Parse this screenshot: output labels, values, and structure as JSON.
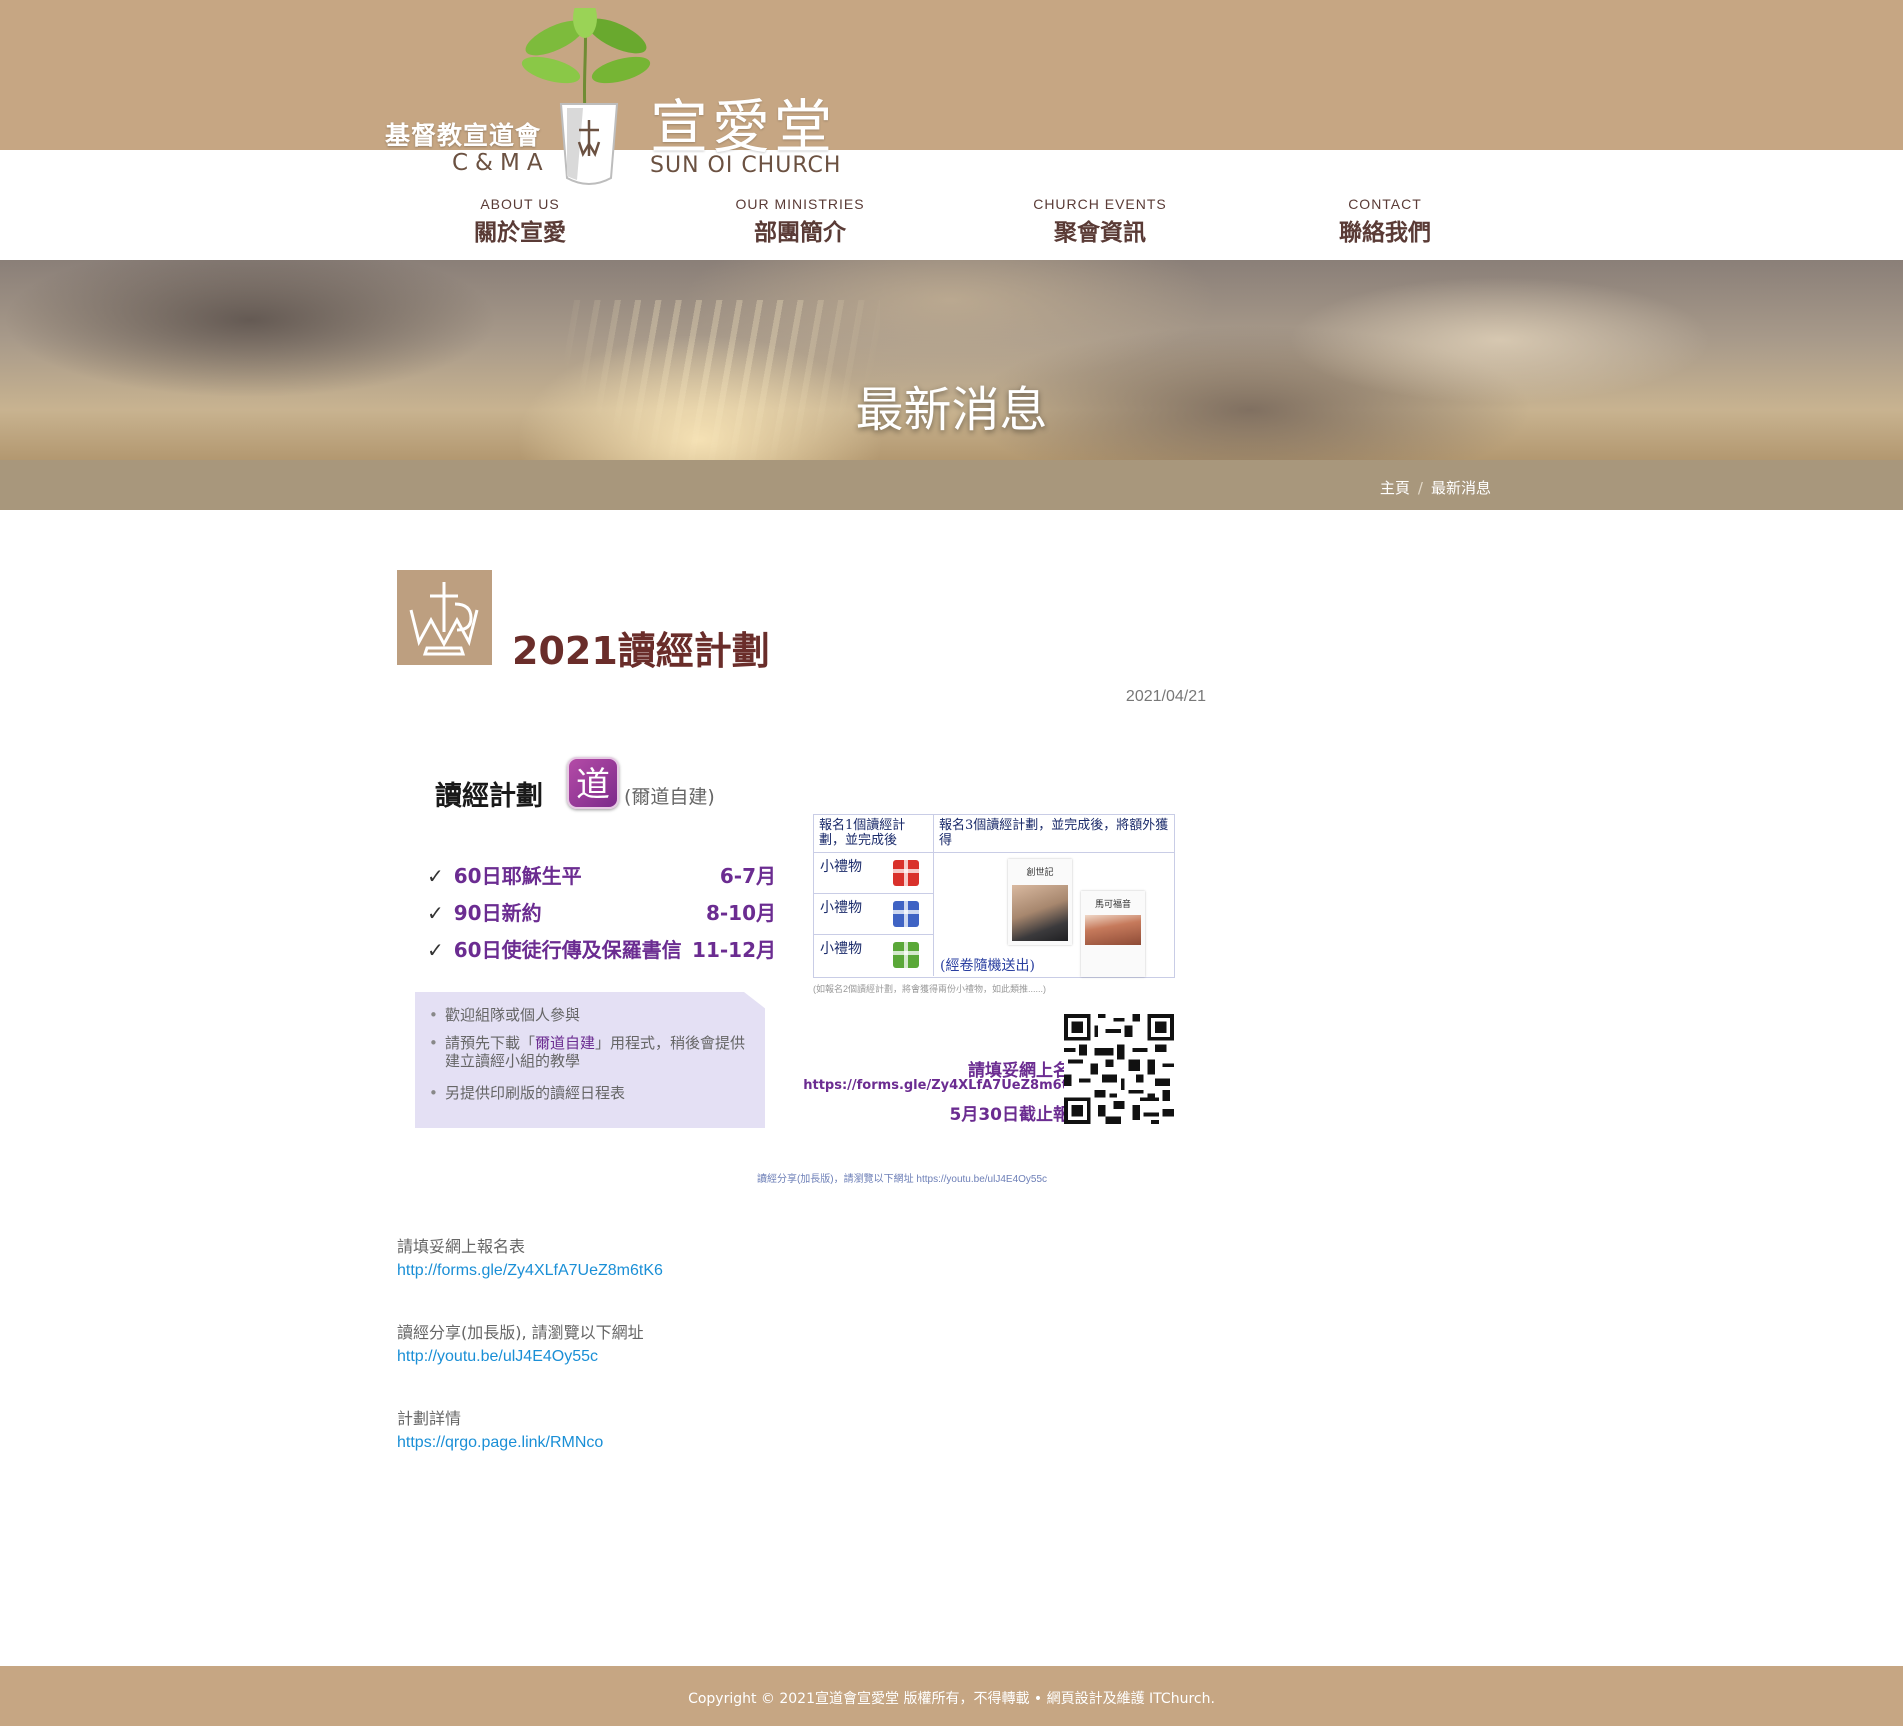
{
  "brand": {
    "name_cn_left": "基督教宣道會",
    "name_en_left": "C&MA",
    "church_cn": "宣愛堂",
    "church_en": "SUN OI CHURCH"
  },
  "nav": [
    {
      "en": "ABOUT US",
      "cn": "關於宣愛"
    },
    {
      "en": "OUR MINISTRIES",
      "cn": "部團簡介"
    },
    {
      "en": "CHURCH EVENTS",
      "cn": "聚會資訊"
    },
    {
      "en": "CONTACT",
      "cn": "聯絡我們"
    }
  ],
  "banner": {
    "title": "最新消息"
  },
  "breadcrumb": {
    "home": "主頁",
    "separator": "/",
    "current": "最新消息"
  },
  "article": {
    "title": "2021讀經計劃",
    "date": "2021/04/21"
  },
  "poster": {
    "title": "讀經計劃",
    "app_glyph": "道",
    "app_name": "(爾道自建)",
    "plans": [
      {
        "name": "60日耶穌生平",
        "months": "6-7月"
      },
      {
        "name": "90日新約",
        "months": "8-10月"
      },
      {
        "name": "60日使徒行傳及保羅書信",
        "months": "11-12月"
      }
    ],
    "notes": {
      "n1": "歡迎組隊或個人參與",
      "n2_pre": "請預先下載「",
      "n2_app": "爾道自建",
      "n2_post": "」用程式，稍後會提供建立讀經小組的教學",
      "n3": "另提供印刷版的讀經日程表"
    },
    "table": {
      "head1": "報名1個讀經計劃，並完成後",
      "head2": "報名3個讀經計劃，並完成後，將額外獲得",
      "gift_label": "小禮物",
      "book1": "創世記",
      "book2": "馬可福音",
      "book_note": "(經卷隨機送出)",
      "tiny_note": "(如報名2個讀經計劃，將會獲得兩份小禮物，如此類推......)"
    },
    "register": {
      "line1": "請填妥網上名表",
      "line2": "https://forms.gle/Zy4XLfA7UeZ8m6tK6",
      "line3": "5月30日截止報名"
    },
    "share_line": "讀經分享(加長版)，請瀏覽以下網址  https://youtu.be/ulJ4E4Oy55c"
  },
  "info": [
    {
      "label": "請填妥網上報名表",
      "link": "http://forms.gle/Zy4XLfA7UeZ8m6tK6"
    },
    {
      "label": "讀經分享(加長版), 請瀏覽以下網址",
      "link": "http://youtu.be/ulJ4E4Oy55c"
    },
    {
      "label": "計劃詳情",
      "link": "https://qrgo.page.link/RMNco"
    }
  ],
  "footer": {
    "text": "Copyright © 2021宣道會宣愛堂 版權所有，不得轉載 • 網頁設計及維護 ITChurch."
  },
  "colors": {
    "header_tan": "#c6a683",
    "breadcrumb_bar": "#a8977c",
    "nav_text": "#5a3b36",
    "title_maroon": "#6a2d2a",
    "poster_purple": "#6b2c91",
    "link_blue": "#1a8fd6"
  },
  "icons": [
    "church-logo-icon",
    "plant-icon",
    "check-icon",
    "gift-icon",
    "qr-code-icon",
    "app-icon"
  ]
}
